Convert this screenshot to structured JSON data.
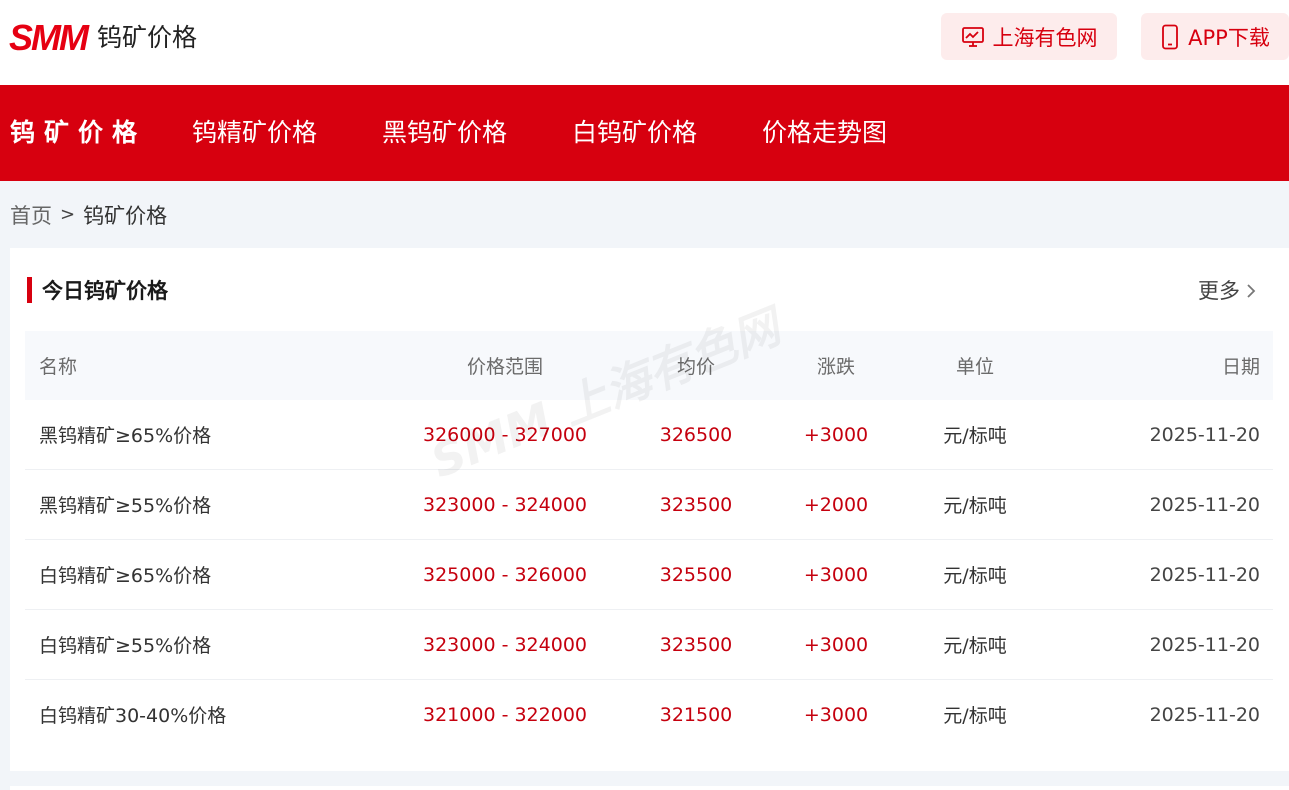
{
  "header": {
    "logo_text": "SMM",
    "page_title": "钨矿价格",
    "web_button": "上海有色网",
    "app_button": "APP下载"
  },
  "nav": {
    "brand": "钨矿价格",
    "items": [
      "钨精矿价格",
      "黑钨矿价格",
      "白钨矿价格",
      "价格走势图"
    ]
  },
  "breadcrumb": {
    "home": "首页",
    "separator": ">",
    "current": "钨矿价格"
  },
  "card": {
    "title": "今日钨矿价格",
    "more": "更多"
  },
  "table": {
    "headers": {
      "name": "名称",
      "range": "价格范围",
      "avg": "均价",
      "change": "涨跌",
      "unit": "单位",
      "date": "日期"
    },
    "rows": [
      {
        "name": "黑钨精矿≥65%价格",
        "range": "326000 - 327000",
        "avg": "326500",
        "change": "+3000",
        "unit": "元/标吨",
        "date": "2025-11-20"
      },
      {
        "name": "黑钨精矿≥55%价格",
        "range": "323000 - 324000",
        "avg": "323500",
        "change": "+2000",
        "unit": "元/标吨",
        "date": "2025-11-20"
      },
      {
        "name": "白钨精矿≥65%价格",
        "range": "325000 - 326000",
        "avg": "325500",
        "change": "+3000",
        "unit": "元/标吨",
        "date": "2025-11-20"
      },
      {
        "name": "白钨精矿≥55%价格",
        "range": "323000 - 324000",
        "avg": "323500",
        "change": "+3000",
        "unit": "元/标吨",
        "date": "2025-11-20"
      },
      {
        "name": "白钨精矿30-40%价格",
        "range": "321000 - 322000",
        "avg": "321500",
        "change": "+3000",
        "unit": "元/标吨",
        "date": "2025-11-20"
      }
    ]
  },
  "watermark": "SMM 上海有色网",
  "colors": {
    "brand_red": "#d7000f",
    "price_red": "#c5000e",
    "button_bg": "#fdecec",
    "page_bg": "#f2f5f9"
  },
  "icons": {
    "web": "monitor-chart-icon",
    "app": "phone-icon",
    "more": "chevron-right-icon"
  }
}
